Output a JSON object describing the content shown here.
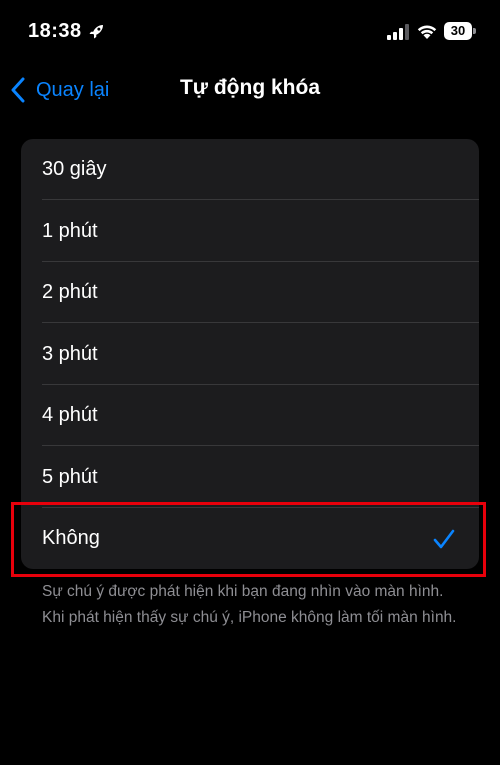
{
  "status": {
    "time": "18:38",
    "battery": "30"
  },
  "nav": {
    "back_label": "Quay lại",
    "title": "Tự động khóa"
  },
  "options": [
    {
      "label": "30 giây",
      "selected": false
    },
    {
      "label": "1 phút",
      "selected": false
    },
    {
      "label": "2 phút",
      "selected": false
    },
    {
      "label": "3 phút",
      "selected": false
    },
    {
      "label": "4 phút",
      "selected": false
    },
    {
      "label": "5 phút",
      "selected": false
    },
    {
      "label": "Không",
      "selected": true
    }
  ],
  "footer": "Sự chú ý được phát hiện khi bạn đang nhìn vào màn hình. Khi phát hiện thấy sự chú ý, iPhone không làm tối màn hình.",
  "colors": {
    "accent": "#0a84ff",
    "highlight_box": "#e8000b"
  },
  "icons": {
    "focus": "rocket-icon",
    "signal": "cellular-signal-icon",
    "wifi": "wifi-icon",
    "battery": "battery-icon",
    "back": "chevron-left-icon",
    "selected": "checkmark-icon"
  }
}
